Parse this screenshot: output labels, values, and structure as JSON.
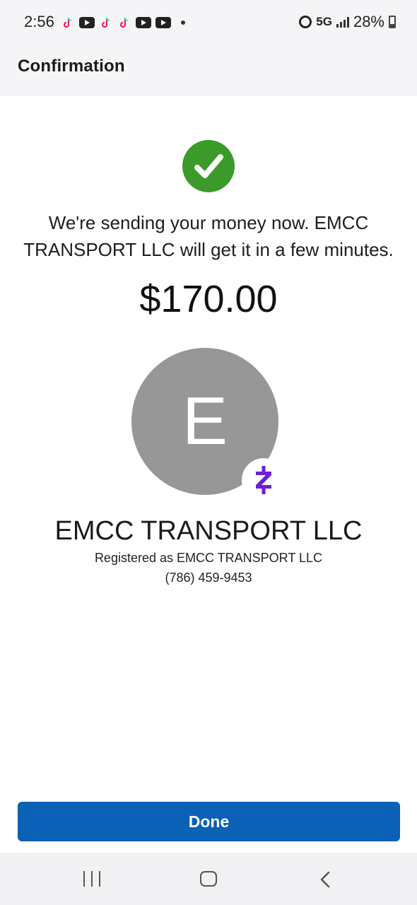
{
  "status_bar": {
    "time": "2:56",
    "network": "5G",
    "battery": "28%",
    "notification_icons": [
      "tiktok-icon",
      "youtube-icon",
      "tiktok-icon",
      "tiktok-icon",
      "youtube-icon",
      "youtube-icon"
    ]
  },
  "header": {
    "title": "Confirmation"
  },
  "confirmation": {
    "message": "We're sending your money now. EMCC TRANSPORT LLC will get it in a few minutes.",
    "amount": "$170.00"
  },
  "recipient": {
    "initial": "E",
    "name": "EMCC TRANSPORT LLC",
    "registered_as": "Registered as EMCC TRANSPORT LLC",
    "phone": "(786) 459-9453"
  },
  "actions": {
    "done_label": "Done"
  },
  "colors": {
    "success": "#3b9a2a",
    "primary": "#0b61b5",
    "zelle": "#6d1ed4",
    "avatar_bg": "#979797"
  }
}
